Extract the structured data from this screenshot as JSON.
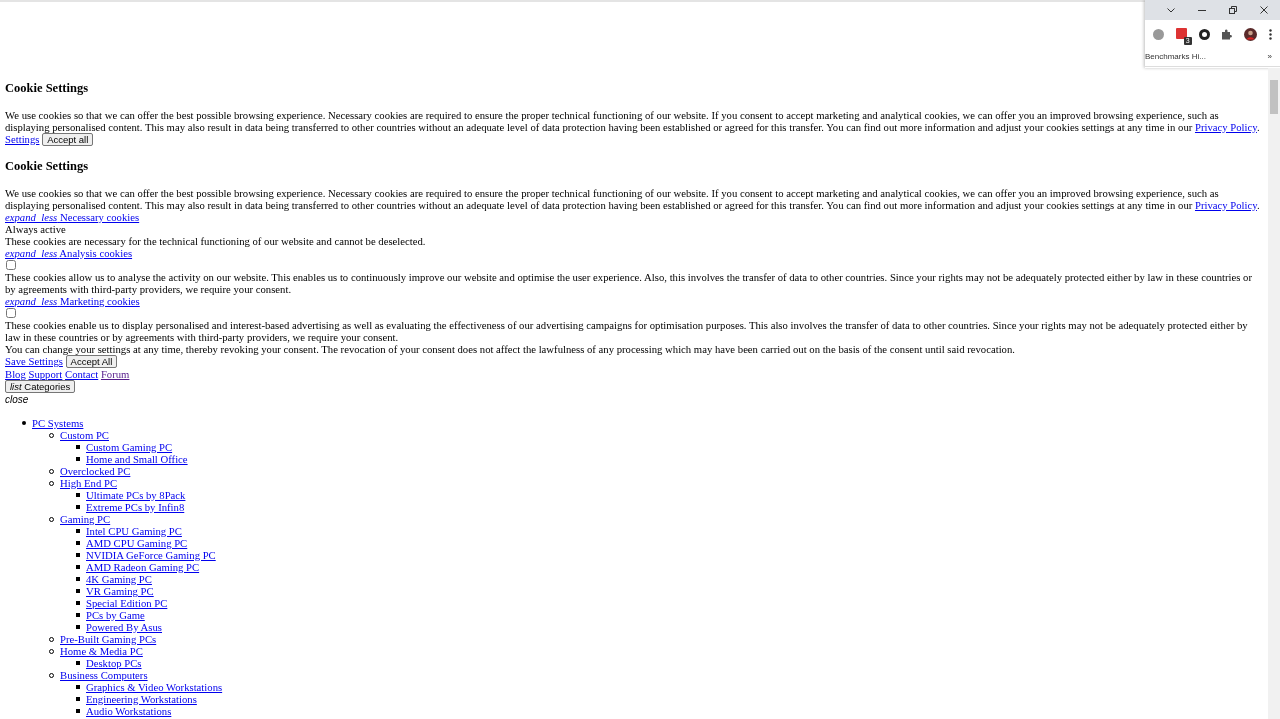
{
  "browser": {
    "extension_badge": "3",
    "bookmark": "Benchmarks Hi...",
    "bookmarks_overflow": "»"
  },
  "banner": {
    "title": "Cookie Settings",
    "text": "We use cookies so that we can offer the best possible browsing experience. Necessary cookies are required to ensure the proper technical functioning of our website. If you consent to accept marketing and analytical cookies, we can offer you an improved browsing experience, such as displaying personalised content. This may also result in data being transferred to other countries without an adequate level of data protection having been established or agreed for this transfer. You can find out more information and adjust your cookies settings at any time in our",
    "link": "Privacy Policy",
    "text_end": ".",
    "settings_link": "Settings",
    "accept_button": "Accept all"
  },
  "settings": {
    "title": "Cookie Settings",
    "text": "We use cookies so that we can offer the best possible browsing experience. Necessary cookies are required to ensure the proper technical functioning of our website. If you consent to accept marketing and analytical cookies, we can offer you an improved browsing experience, such as displaying personalised content. This may also result in data being transferred to other countries without an adequate level of data protection having been established or agreed for this transfer. You can find out more information and adjust your cookies settings at any time in our",
    "link": "Privacy Policy",
    "text_end": ".",
    "sections": [
      {
        "kind": "fixed",
        "icon": "expand_less",
        "title": "Necessary cookies",
        "status": "Always active",
        "description": "These cookies are necessary for the technical functioning of our website and cannot be deselected."
      },
      {
        "kind": "toggle",
        "icon": "expand_less",
        "title": "Analysis cookies",
        "checked": false,
        "description": "These cookies allow us to analyse the activity on our website. This enables us to continuously improve our website and optimise the user experience. Also, this involves the transfer of data to other countries. Since your rights may not be adequately protected either by law in these countries or by agreements with third-party providers, we require your consent."
      },
      {
        "kind": "toggle",
        "icon": "expand_less",
        "title": "Marketing cookies",
        "checked": false,
        "description": "These cookies enable us to display personalised and interest-based advertising as well as evaluating the effectiveness of our advertising campaigns for optimisation purposes. This also involves the transfer of data to other countries. Since your rights may not be adequately protected either by law in these countries or by agreements with third-party providers, we require your consent."
      }
    ],
    "note": "You can change your settings at any time, thereby revoking your consent. The revocation of your consent does not affect the lawfulness of any processing which may have been carried out on the basis of the consent until said revocation.",
    "save_link": "Save Settings",
    "accept_button": "Accept All"
  },
  "nav_links": [
    {
      "label": "Blog",
      "visited": false
    },
    {
      "label": "Support",
      "visited": false
    },
    {
      "label": "Contact",
      "visited": false
    },
    {
      "label": "Forum",
      "visited": true
    }
  ],
  "categories_button": {
    "icon": "list",
    "label": "Categories"
  },
  "close": "close",
  "categories": [
    {
      "label": "PC Systems",
      "children": [
        {
          "label": "Custom PC",
          "children": [
            {
              "label": "Custom Gaming PC"
            },
            {
              "label": "Home and Small Office"
            }
          ]
        },
        {
          "label": "Overclocked PC"
        },
        {
          "label": "High End PC",
          "children": [
            {
              "label": "Ultimate PCs by 8Pack"
            },
            {
              "label": "Extreme PCs by Infin8"
            }
          ]
        },
        {
          "label": "Gaming PC",
          "children": [
            {
              "label": "Intel CPU Gaming PC"
            },
            {
              "label": "AMD CPU Gaming PC"
            },
            {
              "label": "NVIDIA GeForce Gaming PC"
            },
            {
              "label": "AMD Radeon Gaming PC"
            },
            {
              "label": "4K Gaming PC"
            },
            {
              "label": "VR Gaming PC"
            },
            {
              "label": "Special Edition PC"
            },
            {
              "label": "PCs by Game"
            },
            {
              "label": "Powered By Asus"
            }
          ]
        },
        {
          "label": "Pre-Built Gaming PCs"
        },
        {
          "label": "Home & Media PC",
          "children": [
            {
              "label": "Desktop PCs"
            }
          ]
        },
        {
          "label": "Business Computers",
          "children": [
            {
              "label": "Graphics & Video Workstations"
            },
            {
              "label": "Engineering Workstations"
            },
            {
              "label": "Audio Workstations"
            }
          ]
        }
      ]
    }
  ]
}
